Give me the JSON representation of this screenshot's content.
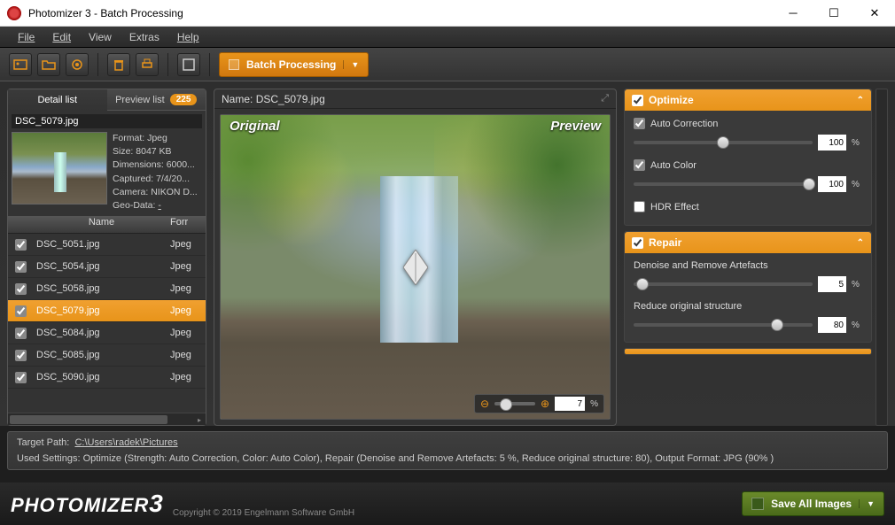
{
  "title": "Photomizer 3 - Batch Processing",
  "menu": {
    "file": "File",
    "edit": "Edit",
    "view": "View",
    "extras": "Extras",
    "help": "Help"
  },
  "mode": "Batch Processing",
  "tabs": {
    "detail": "Detail list",
    "preview": "Preview list",
    "count": "225"
  },
  "selected": {
    "name": "DSC_5079.jpg",
    "meta": {
      "format_label": "Format:",
      "format": "Jpeg",
      "size_label": "Size:",
      "size": "8047 KB",
      "dim_label": "Dimensions:",
      "dim": "6000...",
      "cap_label": "Captured:",
      "cap": "7/4/20...",
      "cam_label": "Camera:",
      "cam": "NIKON D...",
      "geo_label": "Geo-Data:",
      "geo": "-"
    }
  },
  "cols": {
    "name": "Name",
    "format": "Forr"
  },
  "files": [
    {
      "name": "DSC_5051.jpg",
      "fmt": "Jpeg",
      "sel": false
    },
    {
      "name": "DSC_5054.jpg",
      "fmt": "Jpeg",
      "sel": false
    },
    {
      "name": "DSC_5058.jpg",
      "fmt": "Jpeg",
      "sel": false
    },
    {
      "name": "DSC_5079.jpg",
      "fmt": "Jpeg",
      "sel": true
    },
    {
      "name": "DSC_5084.jpg",
      "fmt": "Jpeg",
      "sel": false
    },
    {
      "name": "DSC_5085.jpg",
      "fmt": "Jpeg",
      "sel": false
    },
    {
      "name": "DSC_5090.jpg",
      "fmt": "Jpeg",
      "sel": false
    }
  ],
  "center": {
    "name_label": "Name:",
    "name": "DSC_5079.jpg",
    "original": "Original",
    "preview": "Preview",
    "zoom": "7"
  },
  "optimize": {
    "title": "Optimize",
    "auto_corr": "Auto Correction",
    "auto_corr_val": "100",
    "auto_color": "Auto Color",
    "auto_color_val": "100",
    "hdr": "HDR Effect"
  },
  "repair": {
    "title": "Repair",
    "denoise": "Denoise and Remove Artefacts",
    "denoise_val": "5",
    "reduce": "Reduce original structure",
    "reduce_val": "80"
  },
  "target": {
    "label": "Target Path:",
    "path": "C:\\Users\\radek\\Pictures"
  },
  "settings_label": "Used Settings:",
  "settings": "Optimize (Strength: Auto Correction, Color: Auto Color), Repair (Denoise and Remove Artefacts: 5 %, Reduce original structure: 80), Output Format: JPG (90% )",
  "logo": "PHOTOMIZER",
  "copyright": "Copyright © 2019 Engelmann Software GmbH",
  "save": "Save All Images"
}
